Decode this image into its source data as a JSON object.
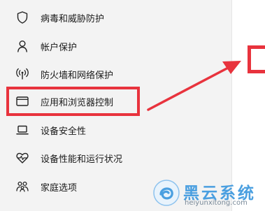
{
  "nav": {
    "items": [
      {
        "label": "病毒和威胁防护",
        "icon": "shield-icon"
      },
      {
        "label": "帐户保护",
        "icon": "person-icon"
      },
      {
        "label": "防火墙和网络保护",
        "icon": "wireless-antenna-icon"
      },
      {
        "label": "应用和浏览器控制",
        "icon": "app-window-icon",
        "highlighted": true
      },
      {
        "label": "设备安全性",
        "icon": "laptop-icon"
      },
      {
        "label": "设备性能和运行状况",
        "icon": "heart-pulse-icon"
      },
      {
        "label": "家庭选项",
        "icon": "family-icon"
      }
    ]
  },
  "annotation": {
    "highlight_color": "#e8333d"
  },
  "watermark": {
    "title": "黑云系统",
    "url": "heiyunxitong.com",
    "logo": "swirl-logo-icon",
    "color": "#4a9fe0"
  }
}
